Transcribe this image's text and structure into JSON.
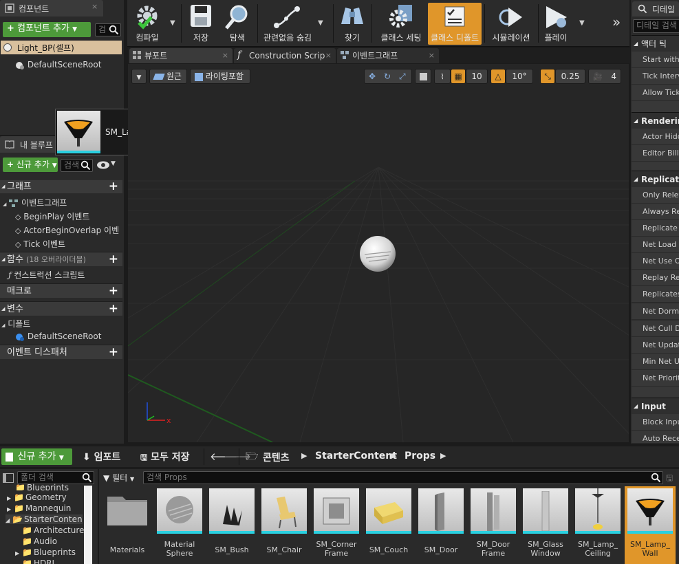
{
  "components_panel": {
    "tab_label": "컴포넌트",
    "add_button": "컴포넌트 추가",
    "search_placeholder": "검",
    "root_item": "Light_BP(셀프)",
    "child_item": "DefaultSceneRoot"
  },
  "drag_tooltip": {
    "label": "SM_Lamp_Wall"
  },
  "my_blueprint": {
    "tab_label": "내 블루프",
    "add_button": "신규 추가",
    "search_placeholder": "검색",
    "sections": {
      "graph": "그래프",
      "functions": "함수",
      "functions_count": "(18 오버라이더블)",
      "macros": "매크로",
      "variables": "변수",
      "components": "디폴트",
      "dispatchers": "이벤트 디스패처"
    },
    "event_graph": "이벤트그래프",
    "events": [
      "BeginPlay 이벤트",
      "ActorBeginOverlap 이벤",
      "Tick 이벤트"
    ],
    "construction_script": "컨스트럭션 스크립트",
    "default_scene_root": "DefaultSceneRoot"
  },
  "toolbar": {
    "compile": "컴파일",
    "save": "저장",
    "browse": "탐색",
    "hide_unrelated": "관련없음 숨김",
    "find": "찾기",
    "class_settings": "클래스 세팅",
    "class_defaults": "클래스 디폴트",
    "simulation": "시뮬레이션",
    "play": "플레이"
  },
  "editor_tabs": [
    "뷰포트",
    "Construction Scrip",
    "이벤트그래프"
  ],
  "viewport_bar": {
    "perspective": "원근",
    "lighting": "라이팅포함",
    "grid_snap": "10",
    "rotation_snap": "10°",
    "scale_snap": "0.25",
    "camera_speed": "4"
  },
  "details": {
    "tab_label": "디테일",
    "search_placeholder": "디테일 검색",
    "sections": {
      "actor_tick": "액터 틱",
      "rendering": "Rendering",
      "replication": "Replication",
      "input": "Input"
    },
    "actor_tick_rows": [
      "Start with",
      "Tick Interv",
      "Allow Tick"
    ],
    "rendering_rows": [
      "Actor Hidd",
      "Editor Billb"
    ],
    "replication_rows": [
      "Only Relev",
      "Always Re",
      "Replicate M",
      "Net Load o",
      "Net Use Ov",
      "Replay Rev",
      "Replicates",
      "Net Dorma",
      "Net Cull Di",
      "Net Update",
      "Min Net Up",
      "Net Priority"
    ],
    "input_rows": [
      "Block Input",
      "Auto Recei"
    ]
  },
  "content_browser": {
    "add_new": "신규 추가",
    "import": "임포트",
    "save_all": "모두 저장",
    "breadcrumb": [
      "콘텐츠",
      "StarterContent",
      "Props"
    ],
    "folder_search_placeholder": "폴더 검색",
    "filter": "필터",
    "asset_search_placeholder": "검색 Props",
    "folders": [
      "Blueprints",
      "Geometry",
      "Mannequin",
      "StarterConten",
      "Architecture",
      "Audio",
      "Blueprints",
      "HDRI"
    ],
    "assets": [
      "Materials",
      "Material\nSphere",
      "SM_Bush",
      "SM_Chair",
      "SM_Corner\nFrame",
      "SM_Couch",
      "SM_Door",
      "SM_Door\nFrame",
      "SM_Glass\nWindow",
      "SM_Lamp_\nCeiling",
      "SM_Lamp_\nWall"
    ]
  },
  "colors": {
    "accent_green": "#4d9a3a",
    "selected_orange": "#e0962a",
    "panel": "#2f2f2f",
    "viewport": "#262626"
  }
}
